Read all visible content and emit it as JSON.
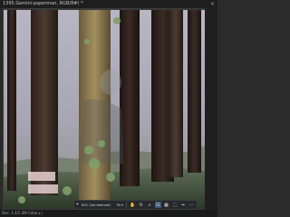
{
  "window": {
    "title": "1395.Gemini-paperman, RGB/8#) *",
    "close_glyph": "×"
  },
  "toolbar": {
    "document_label": "DOC Get featured",
    "fit_label": "Fit ▾",
    "buttons": [
      "hand-icon",
      "rotate-icon",
      "zoom-icon",
      "crop-icon",
      "grid-icon",
      "selection-icon",
      "ruler-icon",
      "more-icon"
    ]
  },
  "status": {
    "text": "Doc: 1.4/1.4M  Color ▸ |"
  },
  "colors": {
    "titlebar": "#1e1e1e",
    "toolbar": "#26282c",
    "accent": "#3d5a7a"
  }
}
